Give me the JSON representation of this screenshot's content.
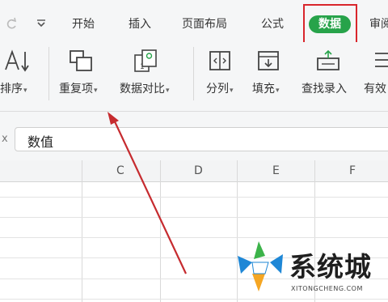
{
  "toolbar": {
    "redo_icon": "redo-icon",
    "dropdown_icon": "chevron-down-icon"
  },
  "tabs": {
    "start": "开始",
    "insert": "插入",
    "page_layout": "页面布局",
    "formulas": "公式",
    "data": "数据",
    "review": "审阅"
  },
  "ribbon": {
    "sort": "排序",
    "duplicates": "重复项",
    "compare": "数据对比",
    "split_column": "分列",
    "fill": "填充",
    "find_entry": "查找录入",
    "validity": "有效"
  },
  "formula_bar": {
    "label": "x",
    "value": "数值"
  },
  "columns": [
    "C",
    "D",
    "E",
    "F"
  ],
  "watermark": {
    "brand": "系统城",
    "url": "XITONGCHENG.COM"
  },
  "colors": {
    "active_tab": "#27a34a",
    "highlight": "#d9262c",
    "arrow": "#c62b2f"
  }
}
